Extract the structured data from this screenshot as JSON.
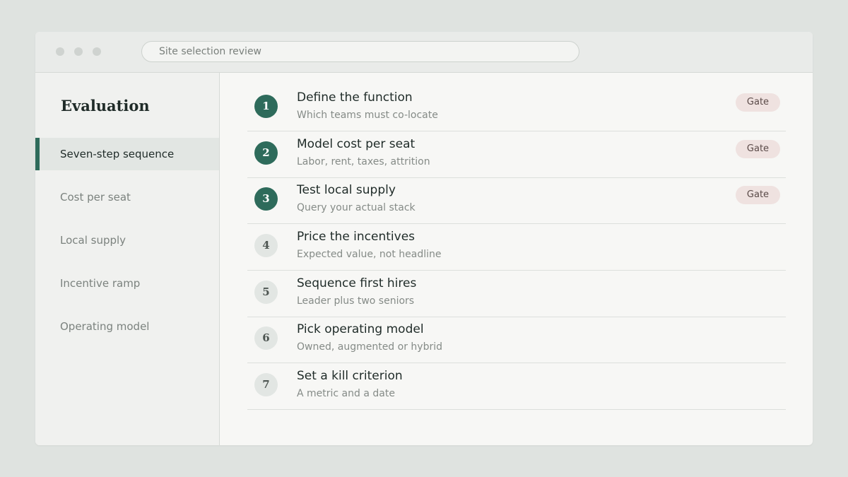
{
  "window": {
    "address": "Site selection review"
  },
  "sidebar": {
    "title": "Evaluation",
    "items": [
      {
        "label": "Seven-step sequence",
        "active": true
      },
      {
        "label": "Cost per seat",
        "active": false
      },
      {
        "label": "Local supply",
        "active": false
      },
      {
        "label": "Incentive ramp",
        "active": false
      },
      {
        "label": "Operating model",
        "active": false
      }
    ]
  },
  "steps": [
    {
      "number": "1",
      "title": "Define the function",
      "subtitle": "Which teams must co-locate",
      "badge": "Gate"
    },
    {
      "number": "2",
      "title": "Model cost per seat",
      "subtitle": "Labor, rent, taxes, attrition",
      "badge": "Gate"
    },
    {
      "number": "3",
      "title": "Test local supply",
      "subtitle": "Query your actual stack",
      "badge": "Gate"
    },
    {
      "number": "4",
      "title": "Price the incentives",
      "subtitle": "Expected value, not headline",
      "badge": ""
    },
    {
      "number": "5",
      "title": "Sequence first hires",
      "subtitle": "Leader plus two seniors",
      "badge": ""
    },
    {
      "number": "6",
      "title": "Pick operating model",
      "subtitle": "Owned, augmented or hybrid",
      "badge": ""
    },
    {
      "number": "7",
      "title": "Set a kill criterion",
      "subtitle": "A metric and a date",
      "badge": ""
    }
  ],
  "colors": {
    "accent": "#2e6b5b",
    "badge_bg": "#efe2e0",
    "background": "#dfe3e0"
  }
}
